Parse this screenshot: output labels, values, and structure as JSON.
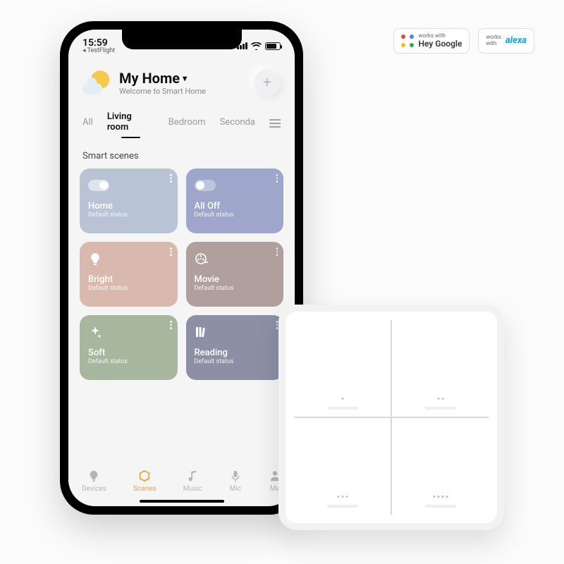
{
  "statusbar": {
    "time": "15:59",
    "back": "◂ TestFlight"
  },
  "header": {
    "title": "My Home",
    "subtitle": "Welcome to Smart Home"
  },
  "tabs": [
    "All",
    "Living room",
    "Bedroom",
    "Seconda"
  ],
  "tabs_active_index": 1,
  "section": "Smart scenes",
  "scenes": [
    {
      "name": "Home",
      "sub": "Default status",
      "color": "#b8c4d6",
      "icon": "toggle-on"
    },
    {
      "name": "All Off",
      "sub": "Default status",
      "color": "#9ea6cc",
      "icon": "toggle-off"
    },
    {
      "name": "Bright",
      "sub": "Default status",
      "color": "#d9b9ae",
      "icon": "bulb"
    },
    {
      "name": "Movie",
      "sub": "Default status",
      "color": "#b19f9e",
      "icon": "film"
    },
    {
      "name": "Soft",
      "sub": "Default status",
      "color": "#a6b79e",
      "icon": "sparkle"
    },
    {
      "name": "Reading",
      "sub": "Default status",
      "color": "#8d8fa5",
      "icon": "books"
    }
  ],
  "nav": [
    {
      "label": "Devices",
      "icon": "bulb"
    },
    {
      "label": "Scenes",
      "icon": "cube"
    },
    {
      "label": "Music",
      "icon": "note"
    },
    {
      "label": "Mic",
      "icon": "mic"
    },
    {
      "label": "Me",
      "icon": "person"
    }
  ],
  "nav_active_index": 1,
  "badges": {
    "google_small": "works with",
    "google_big": "Hey Google",
    "alexa_small": "works\nwith",
    "alexa_big": "alexa"
  }
}
